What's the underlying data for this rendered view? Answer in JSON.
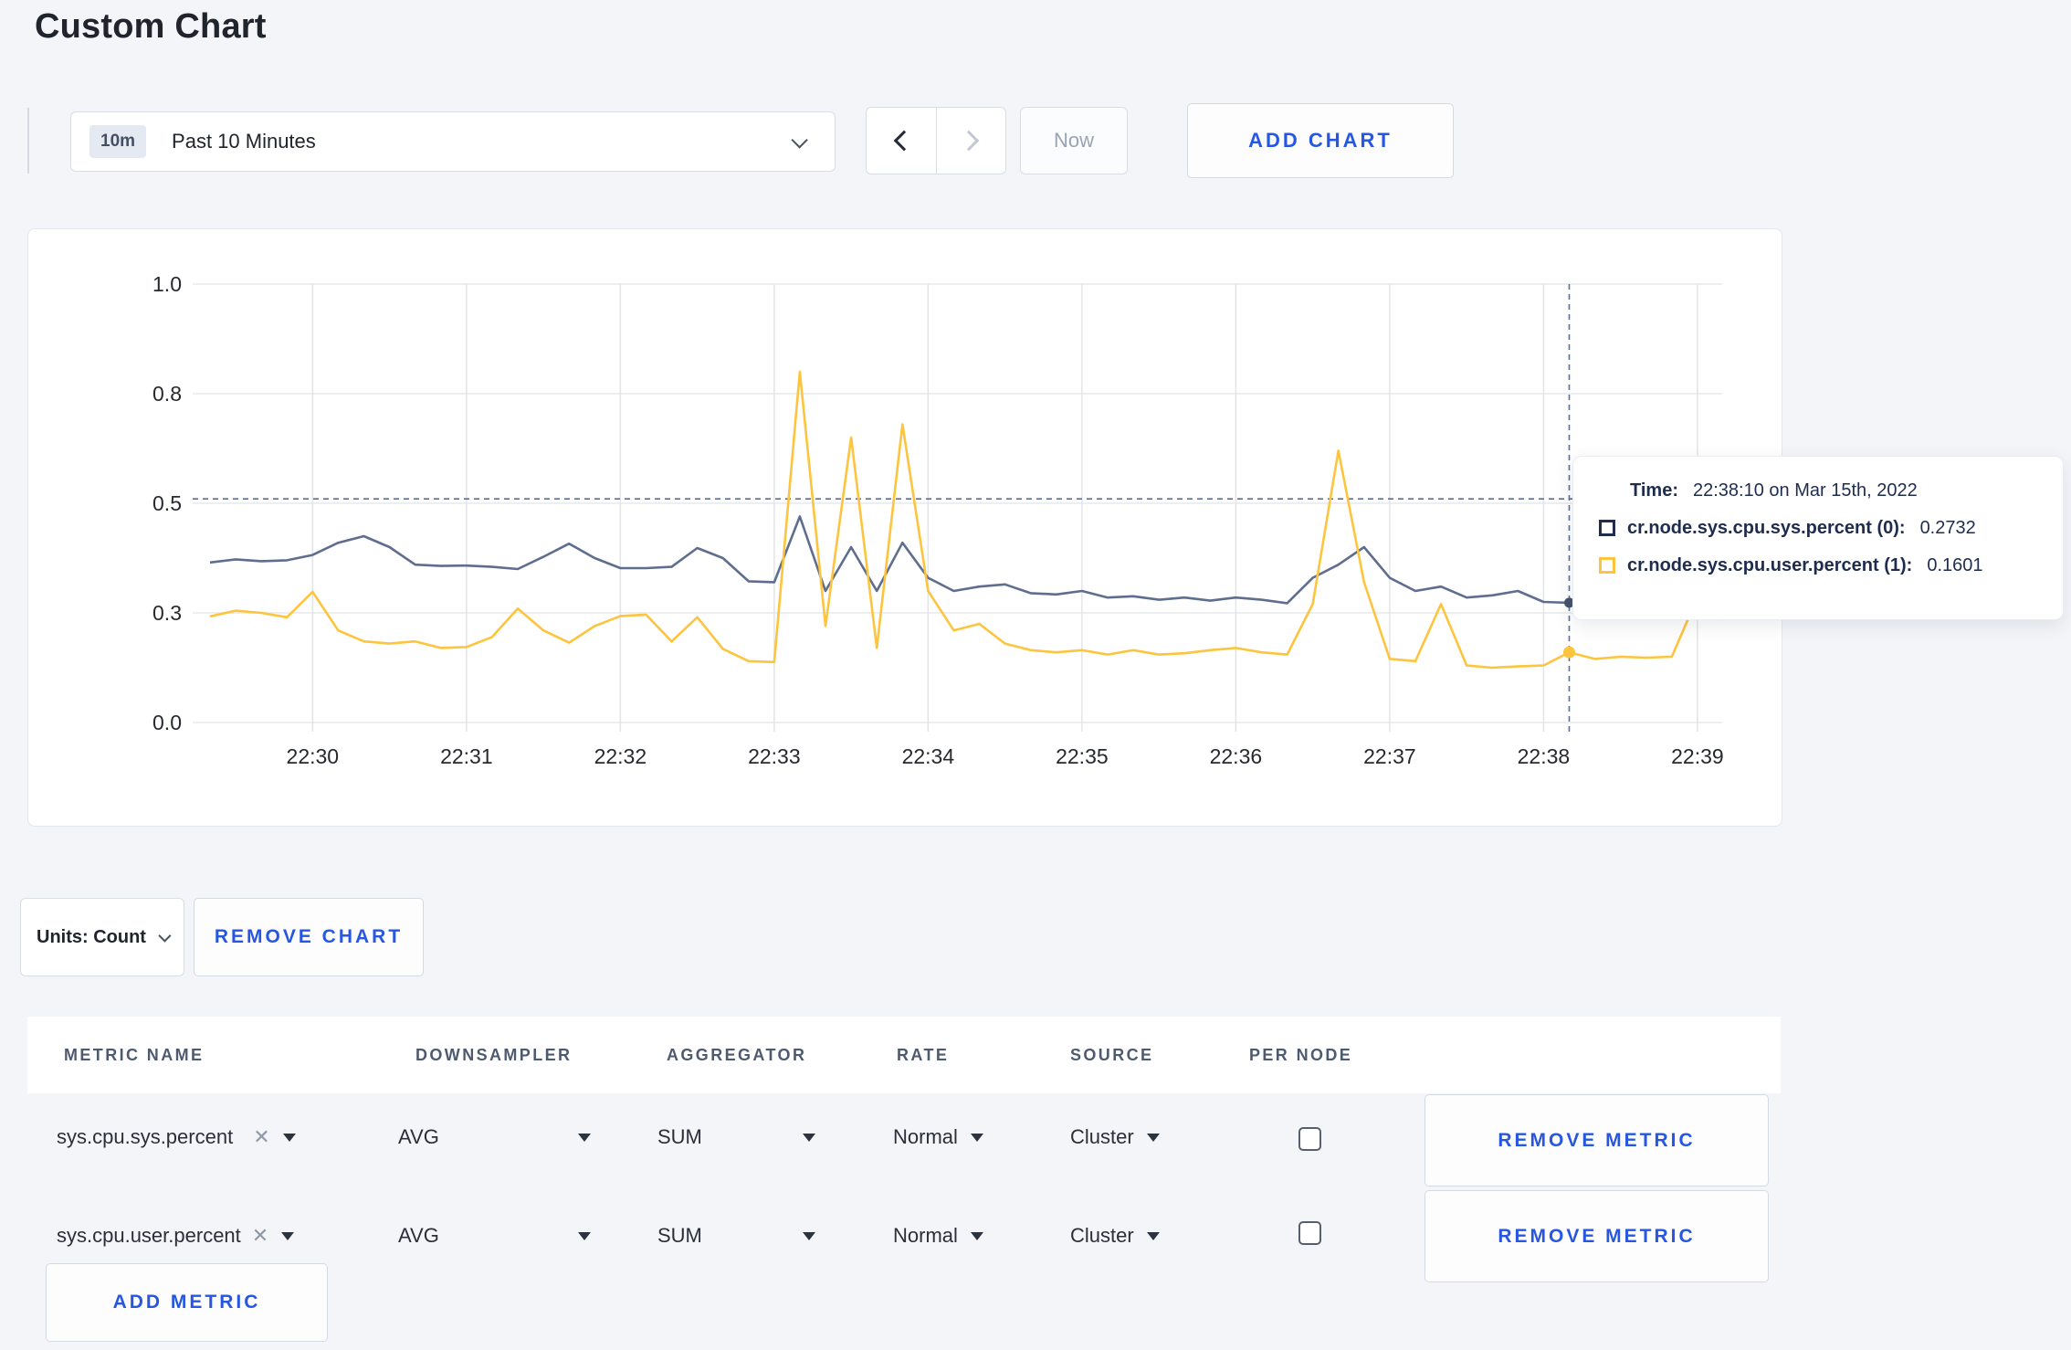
{
  "page_title": "Custom Chart",
  "toolbar": {
    "time_badge": "10m",
    "time_range_label": "Past 10 Minutes",
    "now_label": "Now",
    "add_chart_label": "ADD CHART"
  },
  "chart_data": {
    "type": "line",
    "title": "",
    "xlabel": "",
    "ylabel": "",
    "ylim": [
      0,
      1
    ],
    "grid": true,
    "legend_position": "tooltip",
    "y_ticks": [
      {
        "label": "1.0",
        "value": 1.0
      },
      {
        "label": "0.8",
        "value": 0.75
      },
      {
        "label": "0.5",
        "value": 0.5
      },
      {
        "label": "0.3",
        "value": 0.25
      },
      {
        "label": "0.0",
        "value": 0.0
      }
    ],
    "x_ticks": [
      "22:30",
      "22:31",
      "22:32",
      "22:33",
      "22:34",
      "22:35",
      "22:36",
      "22:37",
      "22:38",
      "22:39"
    ],
    "start_time": "22:29:20",
    "interval_seconds": 10,
    "series": [
      {
        "name": "cr.node.sys.cpu.sys.percent (0)",
        "color": "#5f6e8e",
        "values": [
          0.365,
          0.372,
          0.368,
          0.37,
          0.382,
          0.41,
          0.425,
          0.4,
          0.36,
          0.357,
          0.358,
          0.355,
          0.35,
          0.378,
          0.408,
          0.375,
          0.352,
          0.352,
          0.355,
          0.398,
          0.375,
          0.322,
          0.32,
          0.47,
          0.3,
          0.4,
          0.3,
          0.41,
          0.33,
          0.3,
          0.31,
          0.315,
          0.295,
          0.292,
          0.3,
          0.285,
          0.288,
          0.28,
          0.285,
          0.278,
          0.285,
          0.28,
          0.272,
          0.33,
          0.36,
          0.4,
          0.33,
          0.3,
          0.31,
          0.285,
          0.29,
          0.3,
          0.275,
          0.2732,
          0.295,
          0.3,
          0.295,
          0.3,
          0.295,
          0.3
        ]
      },
      {
        "name": "cr.node.sys.cpu.user.percent (1)",
        "color": "#fdc43e",
        "values": [
          0.242,
          0.255,
          0.25,
          0.24,
          0.298,
          0.21,
          0.185,
          0.18,
          0.185,
          0.17,
          0.172,
          0.195,
          0.26,
          0.21,
          0.182,
          0.22,
          0.243,
          0.246,
          0.185,
          0.24,
          0.168,
          0.14,
          0.138,
          0.8,
          0.22,
          0.65,
          0.17,
          0.68,
          0.3,
          0.21,
          0.225,
          0.18,
          0.165,
          0.16,
          0.165,
          0.155,
          0.165,
          0.155,
          0.158,
          0.165,
          0.17,
          0.16,
          0.155,
          0.27,
          0.62,
          0.32,
          0.145,
          0.14,
          0.27,
          0.13,
          0.125,
          0.128,
          0.13,
          0.1601,
          0.145,
          0.15,
          0.148,
          0.15,
          0.285,
          0.235
        ]
      }
    ],
    "crosshair": {
      "time": "22:38:10",
      "offset_seconds": 530,
      "hline_value": 0.51,
      "point_values": [
        0.2732,
        0.1601
      ]
    }
  },
  "tooltip": {
    "time_label": "Time:",
    "time_value": "22:38:10 on Mar 15th, 2022",
    "rows": [
      {
        "label": "cr.node.sys.cpu.sys.percent (0):",
        "value": "0.2732",
        "color": "#1e2c4e"
      },
      {
        "label": "cr.node.sys.cpu.user.percent (1):",
        "value": "0.1601",
        "color": "#fdc43e"
      }
    ]
  },
  "units_bar": {
    "units_label": "Units: Count",
    "remove_chart_label": "REMOVE CHART"
  },
  "metrics_table": {
    "headers": [
      "METRIC NAME",
      "DOWNSAMPLER",
      "AGGREGATOR",
      "RATE",
      "SOURCE",
      "PER NODE"
    ],
    "remove_metric_label": "REMOVE METRIC",
    "add_metric_label": "ADD METRIC",
    "rows": [
      {
        "name": "sys.cpu.sys.percent",
        "downsampler": "AVG",
        "aggregator": "SUM",
        "rate": "Normal",
        "source": "Cluster",
        "per_node_checked": false
      },
      {
        "name": "sys.cpu.user.percent",
        "downsampler": "AVG",
        "aggregator": "SUM",
        "rate": "Normal",
        "source": "Cluster",
        "per_node_checked": false
      }
    ]
  }
}
